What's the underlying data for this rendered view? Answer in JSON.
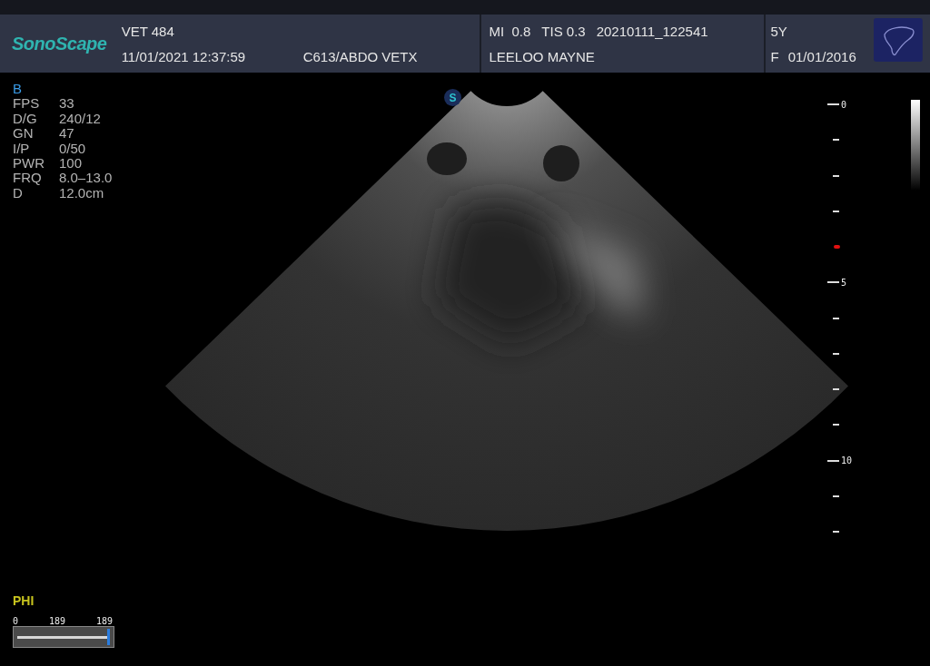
{
  "header": {
    "logo": "SonoScape",
    "hospital": "VET 484",
    "datetime": "11/01/2021 12:37:59",
    "probe": "C613/ABDO VETX",
    "indices": [
      "MI  0.8",
      "TIS 0.3",
      "20210111_122541"
    ],
    "patient": "LEELOO MAYNE",
    "age": "5Y",
    "sex": "F",
    "birth_date": "01/01/2016"
  },
  "probe_mark": "S",
  "params": {
    "mode": "B",
    "rows": [
      {
        "label": "FPS",
        "value": "33"
      },
      {
        "label": "D/G",
        "value": "240/12"
      },
      {
        "label": "GN",
        "value": "47"
      },
      {
        "label": "I/P",
        "value": "0/50"
      },
      {
        "label": "PWR",
        "value": "100"
      },
      {
        "label": "FRQ",
        "value": "8.0–13.0"
      },
      {
        "label": "D",
        "value": "12.0cm"
      }
    ]
  },
  "depth_scale": {
    "ticks": [
      {
        "kind": "major",
        "label": "0"
      },
      {
        "kind": "minor"
      },
      {
        "kind": "minor"
      },
      {
        "kind": "minor"
      },
      {
        "kind": "focus"
      },
      {
        "kind": "major",
        "label": "5"
      },
      {
        "kind": "minor"
      },
      {
        "kind": "minor"
      },
      {
        "kind": "minor"
      },
      {
        "kind": "minor"
      },
      {
        "kind": "major",
        "label": "10"
      },
      {
        "kind": "minor"
      },
      {
        "kind": "minor"
      }
    ]
  },
  "phi": {
    "label": "PHI",
    "scale": [
      "0",
      "189",
      "189"
    ],
    "level": 0.98
  }
}
